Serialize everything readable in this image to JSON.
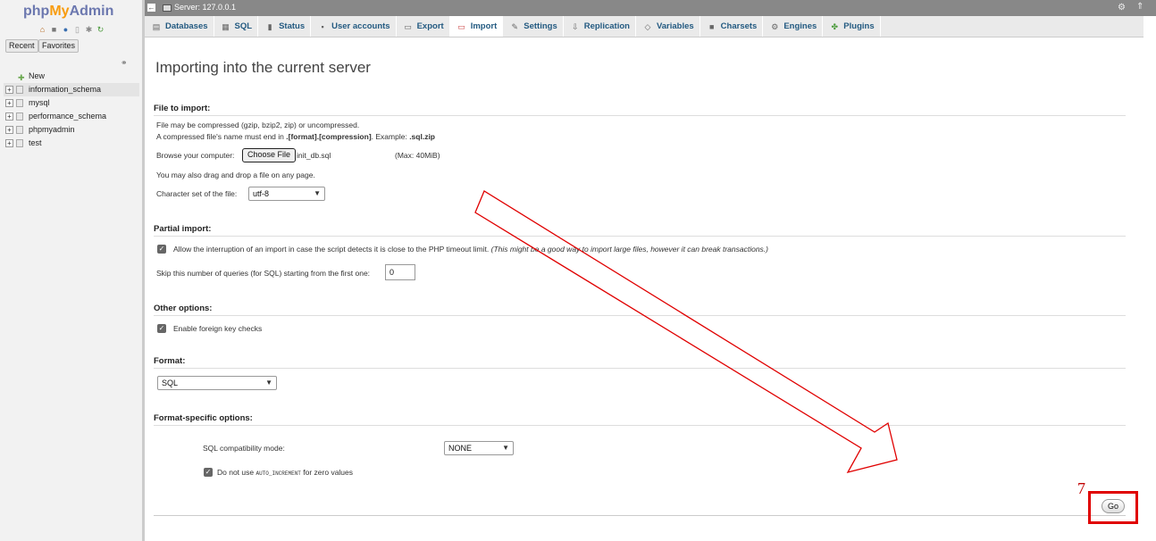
{
  "sidebar": {
    "logo": {
      "php": "php",
      "my": "My",
      "admin": "Admin"
    },
    "tabs": [
      "Recent",
      "Favorites"
    ],
    "tree": [
      {
        "label": "New",
        "type": "new"
      },
      {
        "label": "information_schema",
        "type": "db",
        "active": true
      },
      {
        "label": "mysql",
        "type": "db"
      },
      {
        "label": "performance_schema",
        "type": "db"
      },
      {
        "label": "phpmyadmin",
        "type": "db"
      },
      {
        "label": "test",
        "type": "db"
      }
    ]
  },
  "topbar": {
    "server": "Server: 127.0.0.1"
  },
  "nav": [
    {
      "label": "Databases",
      "icon": "database-icon"
    },
    {
      "label": "SQL",
      "icon": "sql-icon"
    },
    {
      "label": "Status",
      "icon": "status-icon"
    },
    {
      "label": "User accounts",
      "icon": "users-icon"
    },
    {
      "label": "Export",
      "icon": "export-icon"
    },
    {
      "label": "Import",
      "icon": "import-icon",
      "active": true
    },
    {
      "label": "Settings",
      "icon": "wrench-icon"
    },
    {
      "label": "Replication",
      "icon": "replication-icon"
    },
    {
      "label": "Variables",
      "icon": "variables-icon"
    },
    {
      "label": "Charsets",
      "icon": "charset-icon"
    },
    {
      "label": "Engines",
      "icon": "engine-icon"
    },
    {
      "label": "Plugins",
      "icon": "plugin-icon"
    }
  ],
  "main": {
    "title": "Importing into the current server",
    "file": {
      "legend": "File to import:",
      "note1": "File may be compressed (gzip, bzip2, zip) or uncompressed.",
      "note2_pre": "A compressed file's name must end in ",
      "note2_bold": ".[format].[compression]",
      "note2_mid": ". Example: ",
      "note2_ex": ".sql.zip",
      "browse_label": "Browse your computer:",
      "choose_label": "Choose File",
      "filename": "init_db.sql",
      "max": "(Max: 40MiB)",
      "drag": "You may also drag and drop a file on any page.",
      "charset_label": "Character set of the file:",
      "charset_value": "utf-8"
    },
    "partial": {
      "legend": "Partial import:",
      "allow": "Allow the interruption of an import in case the script detects it is close to the PHP timeout limit.",
      "allow_note": "(This might be a good way to import large files, however it can break transactions.)",
      "skip_label": "Skip this number of queries (for SQL) starting from the first one:",
      "skip_value": "0"
    },
    "other": {
      "legend": "Other options:",
      "fk": "Enable foreign key checks"
    },
    "format": {
      "legend": "Format:",
      "value": "SQL"
    },
    "specific": {
      "legend": "Format-specific options:",
      "compat_label": "SQL compatibility mode:",
      "compat_value": "NONE",
      "autoinc_pre": "Do not use ",
      "autoinc_code": "AUTO_INCREMENT",
      "autoinc_post": " for zero values"
    },
    "go": "Go",
    "step_number": "7"
  },
  "colors": {
    "accent": "#235a81",
    "annotation": "#e00000"
  }
}
